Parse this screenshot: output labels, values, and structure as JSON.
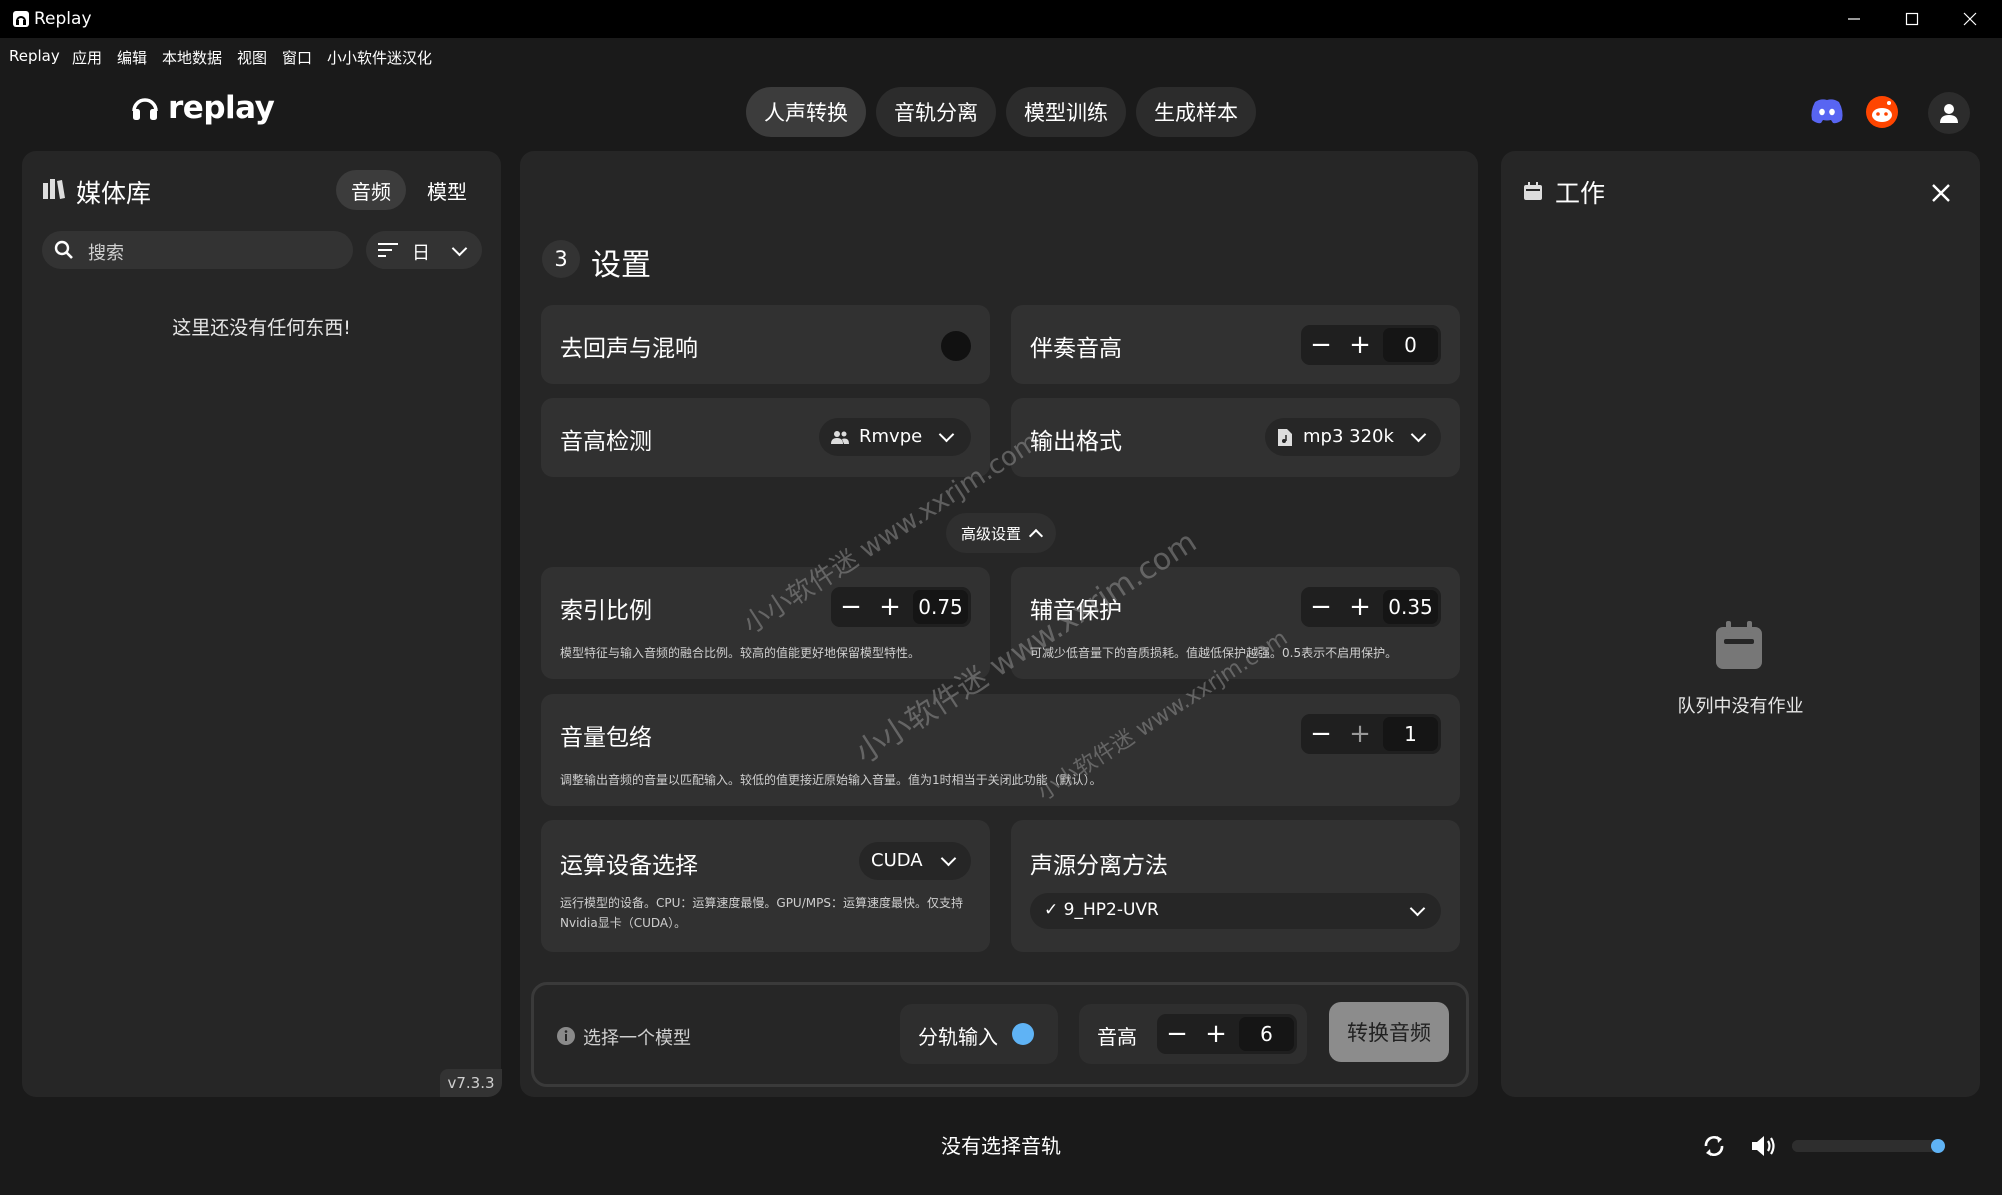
{
  "window": {
    "title": "Replay"
  },
  "menu": [
    "Replay",
    "应用",
    "编辑",
    "本地数据",
    "视图",
    "窗口",
    "小小软件迷汉化"
  ],
  "logo": {
    "text": "replay"
  },
  "nav_tabs": [
    {
      "label": "人声转换",
      "active": true
    },
    {
      "label": "音轨分离",
      "active": false
    },
    {
      "label": "模型训练",
      "active": false
    },
    {
      "label": "生成样本",
      "active": false
    }
  ],
  "library": {
    "title": "媒体库",
    "tabs": [
      "音频",
      "模型"
    ],
    "search_placeholder": "搜索",
    "sort_label": "日",
    "empty_text": "这里还没有任何东西!",
    "version": "v7.3.3"
  },
  "settings": {
    "step_number": "3",
    "title": "设置",
    "dereverb": {
      "label": "去回声与混响",
      "enabled": false
    },
    "accompaniment_pitch": {
      "label": "伴奏音高",
      "value": "0"
    },
    "pitch_detection": {
      "label": "音高检测",
      "selected": "Rmvpe"
    },
    "output_format": {
      "label": "输出格式",
      "selected": "mp3 320k"
    },
    "advanced_toggle": "高级设置",
    "index_ratio": {
      "label": "索引比例",
      "value": "0.75",
      "desc": "模型特征与输入音频的融合比例。较高的值能更好地保留模型特性。"
    },
    "consonant_protection": {
      "label": "辅音保护",
      "value": "0.35",
      "desc": "可减少低音量下的音质损耗。值越低保护越强。0.5表示不启用保护。"
    },
    "volume_envelope": {
      "label": "音量包络",
      "value": "1",
      "desc": "调整输出音频的音量以匹配输入。较低的值更接近原始输入音量。值为1时相当于关闭此功能（默认）。"
    },
    "compute_device": {
      "label": "运算设备选择",
      "selected": "CUDA",
      "desc_line1": "运行模型的设备。CPU：运算速度最慢。GPU/MPS：运算速度最快。仅支持",
      "desc_line2": "Nvidia显卡（CUDA）。"
    },
    "separation_method": {
      "label": "声源分离方法",
      "selected": "✓ 9_HP2-UVR"
    }
  },
  "action_bar": {
    "model_hint": "选择一个模型",
    "split_input_label": "分轨输入",
    "split_input_enabled": true,
    "pitch_label": "音高",
    "pitch_value": "6",
    "convert_button": "转换音频"
  },
  "jobs": {
    "title": "工作",
    "empty_text": "队列中没有作业"
  },
  "player": {
    "status": "没有选择音轨",
    "volume_fraction": 1.0
  },
  "watermarks": [
    "小小软件迷 www.xxrjm.com",
    "小小软件迷 www.xxrjm.com",
    "小小软件迷 www.xxrjm.com"
  ],
  "colors": {
    "accent": "#5fb3f5",
    "discord": "#5865f2",
    "reddit": "#ff4500"
  }
}
